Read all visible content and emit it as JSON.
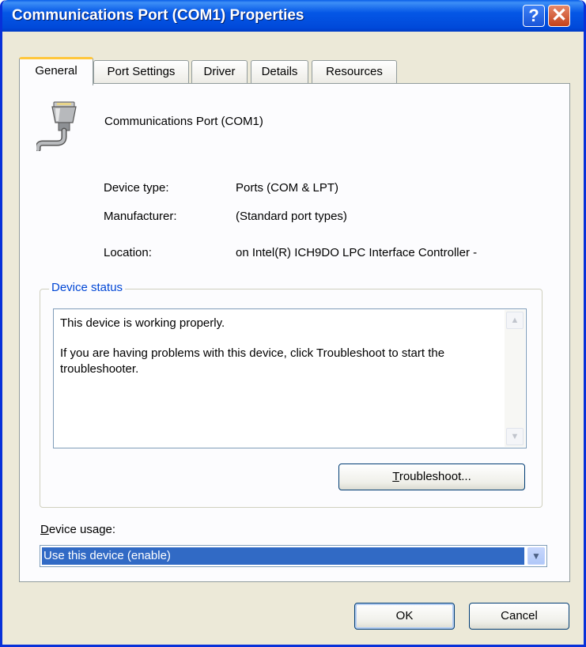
{
  "window": {
    "title": "Communications Port (COM1) Properties",
    "help_glyph": "?",
    "close_glyph": "✕"
  },
  "tabs": [
    {
      "label": "General",
      "active": true
    },
    {
      "label": "Port Settings",
      "active": false
    },
    {
      "label": "Driver",
      "active": false
    },
    {
      "label": "Details",
      "active": false
    },
    {
      "label": "Resources",
      "active": false
    }
  ],
  "device": {
    "name": "Communications Port (COM1)",
    "icon": "serial-port-icon",
    "properties": [
      {
        "label": "Device type:",
        "value": "Ports (COM & LPT)"
      },
      {
        "label": "Manufacturer:",
        "value": "(Standard port types)"
      },
      {
        "label": "Location:",
        "value": "on Intel(R) ICH9DO LPC Interface Controller -"
      }
    ]
  },
  "device_status": {
    "legend": "Device status",
    "line1": "This device is working properly.",
    "line2": "If you are having problems with this device, click Troubleshoot to start the troubleshooter.",
    "troubleshoot_button": {
      "mnemonic": "T",
      "rest": "roubleshoot..."
    }
  },
  "device_usage": {
    "label_mnemonic": "D",
    "label_rest": "evice usage:",
    "selected": "Use this device (enable)"
  },
  "buttons": {
    "ok": "OK",
    "cancel": "Cancel"
  },
  "colors": {
    "titlebar": "#0054e3",
    "dialog_bg": "#ece9d8",
    "selection": "#316ac5",
    "group_legend": "#0046d5",
    "active_tab_accent": "#ffc73c"
  }
}
